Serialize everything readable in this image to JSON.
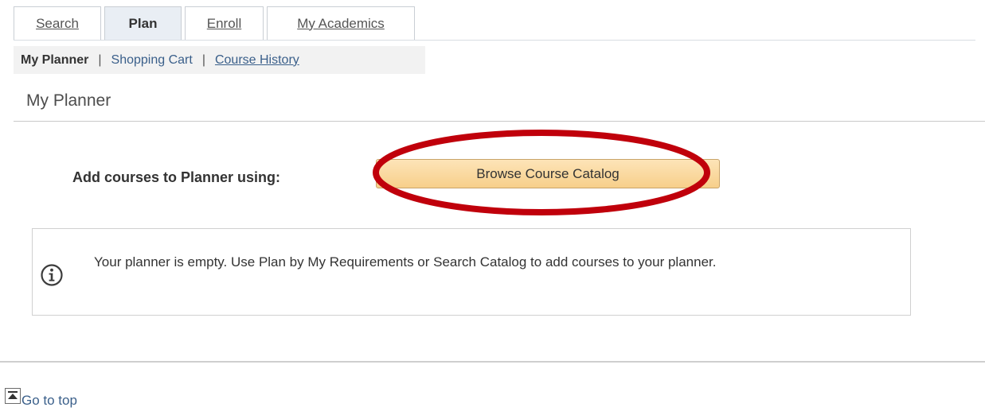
{
  "tabs": [
    {
      "label": "Search",
      "active": false
    },
    {
      "label": "Plan",
      "active": true
    },
    {
      "label": "Enroll",
      "active": false
    },
    {
      "label": "My Academics",
      "active": false
    }
  ],
  "subnav": {
    "current": "My Planner",
    "separator": "|",
    "links": [
      "Shopping Cart",
      "Course History"
    ]
  },
  "page_title": "My Planner",
  "add_courses": {
    "label": "Add courses to Planner using:",
    "button_label": "Browse Course Catalog"
  },
  "message": {
    "icon": "info-icon",
    "text": "Your planner is empty.  Use Plan by My Requirements or Search Catalog to add courses to your planner."
  },
  "footer": {
    "goto_top_label": "Go to top",
    "goto_top_icon": "arrow-up-to-top-icon"
  },
  "colors": {
    "button_fill": "#f7cf8a",
    "highlight_ring": "#c0000b",
    "link": "#3a5f8a",
    "active_tab": "#e9eef4"
  }
}
